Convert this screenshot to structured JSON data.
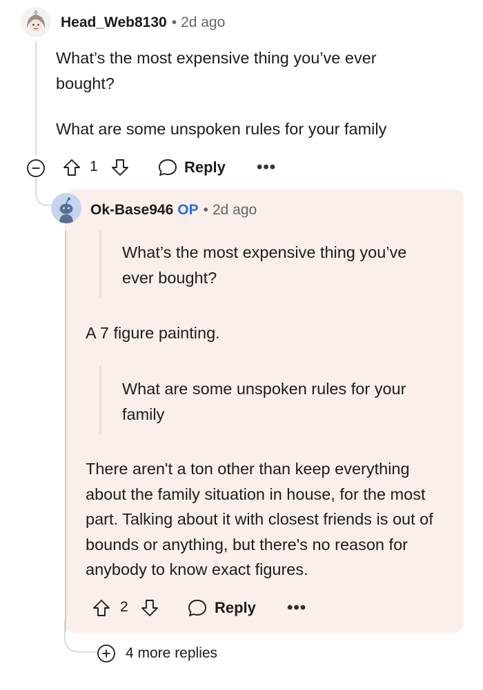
{
  "comment": {
    "username": "Head_Web8130",
    "separator": "•",
    "time": "2d ago",
    "paragraphs": [
      "What’s the most expensive thing you’ve ever bought?",
      "What are some unspoken rules for your family"
    ],
    "vote_count": "1",
    "reply_label": "Reply",
    "more_label": "•••"
  },
  "reply": {
    "username": "Ok-Base946",
    "op_badge": "OP",
    "separator": "•",
    "time": "2d ago",
    "quote1": "What’s the most expensive thing you’ve ever bought?",
    "answer1": "A 7 figure painting.",
    "quote2": "What are some unspoken rules for your family",
    "answer2": "There aren't a ton other than keep everything about the family situation in house, for the most part. Talking about it with closest friends is out of bounds or anything, but there's no reason for anybody to know exact figures.",
    "vote_count": "2",
    "reply_label": "Reply",
    "more_label": "•••"
  },
  "more_replies": "4 more replies",
  "colors": {
    "op_badge": "#2a6ee0",
    "reply_background": "#fbefec",
    "thread_line": "#d9dcdf"
  },
  "icons": [
    "avatar-head-web8130",
    "avatar-snoo",
    "upvote-icon",
    "downvote-icon",
    "comment-bubble-icon",
    "collapse-icon",
    "expand-icon"
  ]
}
